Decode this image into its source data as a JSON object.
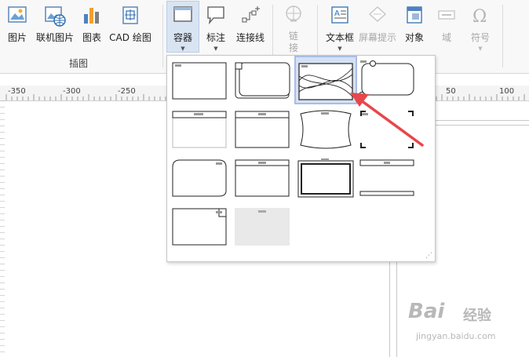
{
  "ribbon": {
    "group_label": "插图",
    "buttons": [
      {
        "label": "图片"
      },
      {
        "label": "联机图片"
      },
      {
        "label": "图表"
      },
      {
        "label": "CAD 绘图"
      },
      {
        "label": "容器"
      },
      {
        "label": "标注"
      },
      {
        "label": "连接线"
      },
      {
        "label": "链\n接"
      },
      {
        "label": "文本框"
      },
      {
        "label": "屏幕提示"
      },
      {
        "label": "对象"
      },
      {
        "label": "域"
      },
      {
        "label": "符号"
      }
    ]
  },
  "ruler": {
    "labels": [
      "-350",
      "-300",
      "-250",
      "50",
      "100"
    ]
  },
  "gallery": {
    "items": [
      {
        "name": "classic"
      },
      {
        "name": "banner"
      },
      {
        "name": "wave",
        "selected": true
      },
      {
        "name": "pin"
      },
      {
        "name": "bar-top"
      },
      {
        "name": "top-title"
      },
      {
        "name": "curve"
      },
      {
        "name": "corners"
      },
      {
        "name": "rounded-top"
      },
      {
        "name": "frame-title"
      },
      {
        "name": "double-frame"
      },
      {
        "name": "lines"
      },
      {
        "name": "tab-right"
      },
      {
        "name": "grey-fill"
      }
    ]
  },
  "watermark": {
    "brand": "Bai",
    "sub": "经验",
    "url": "jingyan.baidu.com"
  },
  "colors": {
    "selection_bg": "#d5e1f3",
    "arrow": "#e8464b"
  }
}
